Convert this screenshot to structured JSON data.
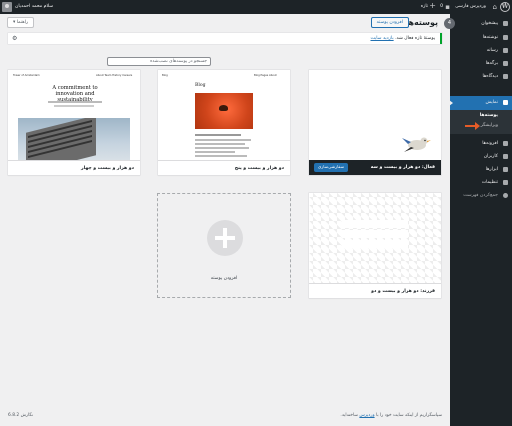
{
  "admin_bar": {
    "site_title": "وردپرس فارسی",
    "comments_count": "0",
    "new_label": "تازه",
    "greeting": "سلام محمد احمدیان"
  },
  "sidebar": {
    "items": [
      {
        "label": "پیشخوان",
        "icon": "dashboard-icon"
      },
      {
        "label": "نوشته‌ها",
        "icon": "pin-icon"
      },
      {
        "label": "رسانه",
        "icon": "media-icon"
      },
      {
        "label": "برگه‌ها",
        "icon": "page-icon"
      },
      {
        "label": "دیدگاه‌ها",
        "icon": "comment-icon"
      },
      {
        "label": "نمایش",
        "icon": "brush-icon"
      },
      {
        "label": "افزونه‌ها",
        "icon": "plugin-icon"
      },
      {
        "label": "کاربران",
        "icon": "users-icon"
      },
      {
        "label": "ابزارها",
        "icon": "wrench-icon"
      },
      {
        "label": "تنظیمات",
        "icon": "settings-icon"
      },
      {
        "label": "جمع‌کردن فهرست",
        "icon": "collapse-icon"
      }
    ],
    "submenu": [
      "پوسته‌ها",
      "ویرایشگر"
    ]
  },
  "page": {
    "title": "پوسته‌ها",
    "count": "4",
    "add_new_button": "افزودن پوسته",
    "help_button": "راهنما ▾",
    "notice_text": "پوستهٔ تازه فعال شد.",
    "notice_link": "بازدید سایت",
    "search_placeholder": "جستجو در پوسته‌های نصب‌شده"
  },
  "themes": [
    {
      "name": "دو هزار و بیست و سه",
      "active": true,
      "active_prefix": "فعال:",
      "customize_button": "سفارشی‌سازی",
      "preview_logo": "∞",
      "preview_text": "The Hatchery: a blog about adventures in bird watching."
    },
    {
      "name": "دو هزار و بیست و پنج",
      "preview_site": "Blog",
      "preview_nav": "Blog   Pages   About"
    },
    {
      "name": "دو هزار و بیست و چهار",
      "preview_site": "Tower of Amsterdam",
      "preview_nav": "About   Team   History   Careers",
      "preview_heading": "A commitment to innovation and sustainability"
    },
    {
      "name": "دو هزار و بیست و دو",
      "child_prefix": "فرزند:"
    }
  ],
  "add_new_tile": {
    "label": "افزودن پوسته"
  },
  "footer": {
    "thanks_prefix": "سپاسگزاریم از اینکه سایت خود را با",
    "thanks_link": "وردپرس",
    "thanks_suffix": "ساخته‌اید.",
    "version": "نگارش 6.8.2"
  },
  "colors": {
    "admin_dark": "#1d2327",
    "accent": "#2271b1",
    "notice_success": "#00a32a",
    "background": "#f0f0f1"
  }
}
